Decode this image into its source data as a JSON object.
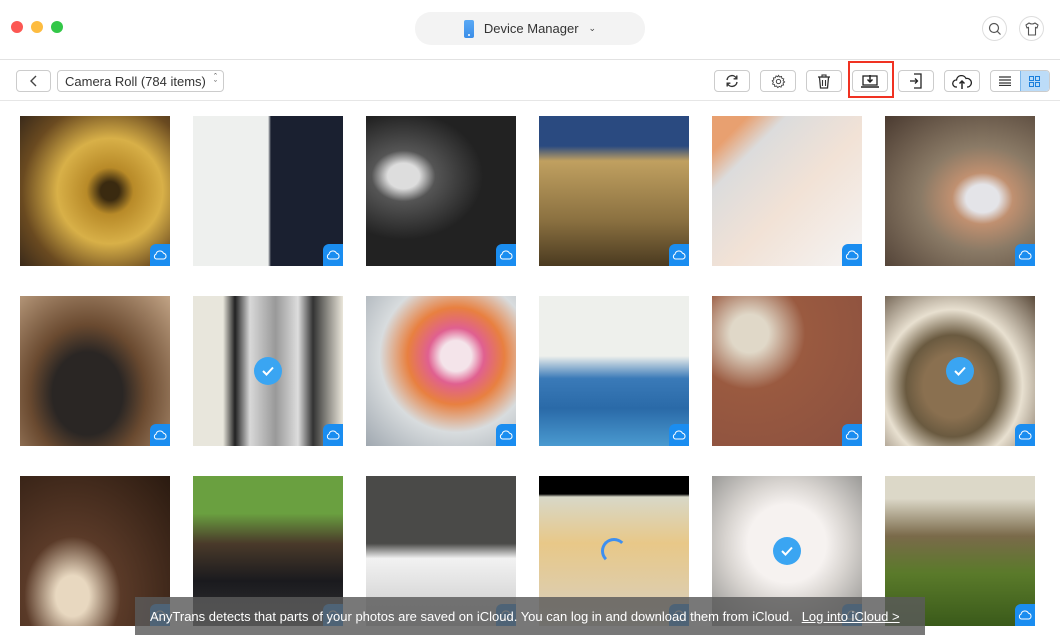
{
  "window": {
    "title": "Device Manager",
    "traffic_lights": [
      "close",
      "minimize",
      "zoom"
    ]
  },
  "header": {
    "device_label": "Device Manager",
    "device_icon": "phone-icon",
    "right_icons": [
      "search-icon",
      "tshirt-icon"
    ]
  },
  "toolbar": {
    "back_icon": "chevron-left-icon",
    "album_select": "Camera Roll (784 items)",
    "buttons": [
      {
        "name": "refresh",
        "icon": "refresh-icon"
      },
      {
        "name": "settings",
        "icon": "gear-icon"
      },
      {
        "name": "delete",
        "icon": "trash-icon"
      },
      {
        "name": "export-to-computer",
        "icon": "export-to-computer-icon",
        "highlighted": true
      },
      {
        "name": "send-to-device",
        "icon": "send-to-device-icon"
      },
      {
        "name": "upload-to-icloud",
        "icon": "cloud-upload-icon"
      }
    ],
    "view_modes": [
      {
        "name": "list",
        "icon": "list-icon",
        "active": false
      },
      {
        "name": "grid",
        "icon": "grid-icon",
        "active": true
      }
    ],
    "highlight_color": "#f03222"
  },
  "photos": [
    {
      "subject": "Gold gramophone horn",
      "icloud": true,
      "selected": false
    },
    {
      "subject": "Computer monitor desktop",
      "icloud": true,
      "selected": false
    },
    {
      "subject": "Vintage car front",
      "icloud": true,
      "selected": false
    },
    {
      "subject": "Building at night with street lamp",
      "icloud": true,
      "selected": false
    },
    {
      "subject": "Tissue box on desk",
      "icloud": true,
      "selected": false
    },
    {
      "subject": "Hand holding iPhone",
      "icloud": true,
      "selected": false
    },
    {
      "subject": "Vintage twin-lens camera",
      "icloud": true,
      "selected": false
    },
    {
      "subject": "Penguins",
      "icloud": true,
      "selected": true
    },
    {
      "subject": "Cake with flowers and fruit",
      "icloud": true,
      "selected": false
    },
    {
      "subject": "Paper craft window and sea",
      "icloud": true,
      "selected": false
    },
    {
      "subject": "Pixel art cookies on wood",
      "icloud": true,
      "selected": false
    },
    {
      "subject": "Tabby cat",
      "icloud": true,
      "selected": true
    },
    {
      "subject": "Flour bowl and milk jug",
      "icloud": true,
      "selected": false
    },
    {
      "subject": "Office with tree and monitors",
      "icloud": true,
      "selected": false
    },
    {
      "subject": "Laptop screen",
      "icloud": true,
      "selected": false
    },
    {
      "subject": "Cakes on table",
      "icloud": true,
      "selected": false,
      "loading": true
    },
    {
      "subject": "White cat face",
      "icloud": true,
      "selected": true
    },
    {
      "subject": "Trees at sunrise",
      "icloud": true,
      "selected": false
    }
  ],
  "notice": {
    "message": "AnyTrans detects that parts of your photos are saved on iCloud. You can log in and download them from iCloud.",
    "link": "Log into iCloud >"
  },
  "colors": {
    "accent": "#1a8df0",
    "check": "#3aa5f2",
    "view_active": "#bcdcf8"
  }
}
